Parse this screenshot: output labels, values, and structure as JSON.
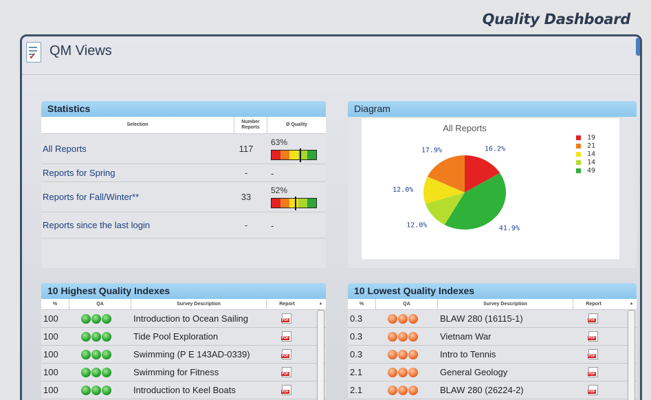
{
  "page_title": "Quality Dashboard",
  "window": {
    "title": "QM Views"
  },
  "statistics": {
    "title": "Statistics",
    "headers": {
      "selection": "Selection",
      "number_reports": "Number Reports",
      "quality": "Ø Quality"
    },
    "rows": [
      {
        "label": "All Reports",
        "count": "117",
        "quality": "63%",
        "quality_value": 0.63
      },
      {
        "label": "Reports for Spring",
        "count": "-",
        "quality": "-",
        "quality_value": null
      },
      {
        "label": "Reports for Fall/Winter**",
        "count": "33",
        "quality": "52%",
        "quality_value": 0.52
      },
      {
        "label": "Reports since the last login",
        "count": "-",
        "quality": "-",
        "quality_value": null
      }
    ],
    "bar_colors": [
      "#e52222",
      "#f07c1d",
      "#f3e11b",
      "#a9d62b",
      "#2fa43a"
    ]
  },
  "diagram": {
    "title": "Diagram",
    "chart_data": {
      "type": "pie",
      "title": "All Reports",
      "slices": [
        {
          "label": "19",
          "value": 19,
          "percent": "16.2%",
          "color": "#e52222"
        },
        {
          "label": "21",
          "value": 21,
          "percent": "17.9%",
          "color": "#f07c1d"
        },
        {
          "label": "14",
          "value": 14,
          "percent": "12.0%",
          "color": "#f3e11b"
        },
        {
          "label": "14",
          "value": 14,
          "percent": "12.0%",
          "color": "#b5dd2e"
        },
        {
          "label": "49",
          "value": 49,
          "percent": "41.9%",
          "color": "#2fb13a"
        }
      ],
      "legend_position": "right"
    }
  },
  "highest": {
    "title": "10 Highest Quality Indexes",
    "headers": {
      "pct": "%",
      "qa": "QA",
      "desc": "Survey Description",
      "report": "Report"
    },
    "rows": [
      {
        "pct": "100",
        "desc": "Introduction to Ocean Sailing",
        "qa": "green"
      },
      {
        "pct": "100",
        "desc": "Tide Pool Exploration",
        "qa": "green"
      },
      {
        "pct": "100",
        "desc": "Swimming (P E 143AD-0339)",
        "qa": "green"
      },
      {
        "pct": "100",
        "desc": "Swimming for Fitness",
        "qa": "green"
      },
      {
        "pct": "100",
        "desc": "Introduction to Keel Boats",
        "qa": "green"
      }
    ]
  },
  "lowest": {
    "title": "10 Lowest Quality Indexes",
    "headers": {
      "pct": "%",
      "qa": "QA",
      "desc": "Survey Description",
      "report": "Report"
    },
    "rows": [
      {
        "pct": "0.3",
        "desc": "BLAW 280 (16115-1)",
        "qa": "orange"
      },
      {
        "pct": "0.3",
        "desc": "Vietnam War",
        "qa": "orange"
      },
      {
        "pct": "0.3",
        "desc": "Intro to Tennis",
        "qa": "orange"
      },
      {
        "pct": "2.1",
        "desc": "General Geology",
        "qa": "orange"
      },
      {
        "pct": "2.1",
        "desc": "BLAW 280 (26224-2)",
        "qa": "orange"
      }
    ]
  }
}
